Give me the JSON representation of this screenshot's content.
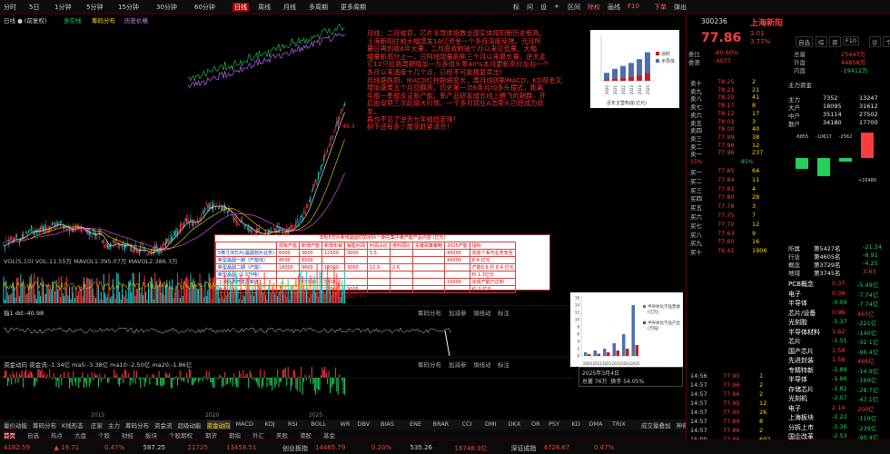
{
  "top_tabs": [
    "分时",
    "5日",
    "1分钟",
    "5分钟",
    "15分钟",
    "30分钟",
    "60分钟",
    "日线",
    "周线",
    "月线",
    "多周期",
    "更多周期"
  ],
  "top_right": [
    "标",
    "问",
    "设",
    "+",
    "区间",
    "除权",
    "画线",
    "F10",
    "下单",
    "弹出"
  ],
  "ticker_title": "300236 上海新阳",
  "main_legend": [
    {
      "text": "日线 ● (前复权)",
      "color": "#cccccc"
    },
    {
      "text": "多空线",
      "color": "#22d05a"
    },
    {
      "text": "筹码分布",
      "color": "#ffd800"
    },
    {
      "text": "历史价格",
      "color": "#d68cff"
    }
  ],
  "annotation": [
    "月线：二月收官，芯片半导体指数全部实体阳刻新历史新高。",
    "上海新阳往前大幅增发18亿资金一个多月深度反弹。元月所",
    "量日再创收6年大量，二月底收前轴个月以来见低量。大幅",
    "缩量新高分止一，日阿线增量刷新三个月以来最长量，逆天走",
    "它12只拉高周期增加一方多组头筹40%本月更新高价左右一个",
    "多月以来温度十几个点，已经不可能报复卖出！",
    "月线盛跌阴，MACD红柱刷缩变长，周月线则刷MACD，KD双金叉",
    "增加盛周五个月回翻高，历史第一次6条月均多头摆式，距离",
    "年报一季报反证新产能，新产品研发成长线上腾飞的期群，开",
    "启由安禁三次起级大行情，一个多月就业A浩荣头已经成为欢",
    "友。",
    "再也不见了逆天七年栈低走珠！",
    "树下还有多少尾货赶紧清仓！"
  ],
  "price_mark": "49.3",
  "ind1_label": "VOL(5,10) VOL:11.55万 MAVOL1:395.07万 MAVOL2:386.3万",
  "ind2_label": "指1 dd:-40.98",
  "ind3_label": "资金动向  资金流:-1.34亿 ma5:-3.38亿 ma10:-2.50亿 ma20:-1.86亿",
  "ind_btns": [
    "筹码分布",
    "加减参",
    "填线动",
    "标注"
  ],
  "table_title": "本轮5万片新增晶圆切割划片一期在集中量产能产品内容 (亿元)",
  "table_headers": [
    "",
    "现有产能",
    "新增产能",
    "新增年销",
    "销售利润",
    "利润占比",
    "增利润比",
    "关键政策策略",
    "2025产能",
    "指标"
  ],
  "table_rows": [
    [
      "5英寸/8万片(晶圆划片业务)",
      "6000",
      "3000",
      "12500",
      "3000",
      "5.5",
      "",
      "45000",
      "完成个系与业务安全"
    ],
    [
      "新型晶圆一期（产能线）",
      "4500",
      "6500",
      "",
      "",
      "",
      "",
      "43000",
      "8.4 亿元"
    ],
    [
      "新型晶圆二期（产能）",
      "18000",
      "9000",
      "13000",
      "3000",
      "12.9",
      "2.6",
      "",
      "产能5.6 约 8.4 亿元"
    ],
    [
      "新型晶圆（1.3万吨）",
      "",
      "",
      "",
      "",
      "",
      "",
      "",
      "PI 1.3亿元"
    ],
    [
      "上海经济开发区新增",
      "",
      "15000",
      "5000",
      "",
      "",
      "",
      "10000",
      "完成产能已达到"
    ],
    [
      "合计",
      "",
      "",
      "25000",
      "9000",
      "",
      "",
      "",
      "约 3 亿元"
    ]
  ],
  "table_footer": "已达到新产品产能需求的比例，预期是新产品市场规模，销售规模占比 5%",
  "chart1": {
    "type": "bar",
    "categories": [
      "2020",
      "2021",
      "2022",
      "2023",
      "2024",
      "2025"
    ],
    "series": [
      {
        "name": "涂料",
        "values": [
          2,
          3,
          4,
          5,
          7,
          9
        ]
      },
      {
        "name": "半导体",
        "values": [
          6,
          9,
          11,
          13,
          15,
          20
        ]
      }
    ],
    "xlabel": "近年主营构成(亿元)"
  },
  "chart2": {
    "type": "bar",
    "categories": [
      "2020",
      "2021",
      "2022",
      "2023",
      "2024",
      "2025"
    ],
    "series": [
      {
        "name": "半导体化学品营收(亿元)",
        "values": [
          1,
          1.5,
          2,
          3.5,
          6,
          14
        ]
      },
      {
        "name": "半导体化学品产出(万吨)",
        "values": [
          0.5,
          0.6,
          1,
          1.5,
          2,
          3
        ]
      }
    ],
    "ylim": [
      0,
      16
    ]
  },
  "date_box": {
    "date": "2025年3月4日",
    "vol": "总量 76万",
    "pct": "换手 54.05%"
  },
  "sidebar": {
    "code": "300236",
    "name": "上海新阳",
    "price": "77.86",
    "change": "3.01",
    "pct": "3.77%",
    "tabs": [
      "自选",
      "综",
      "资",
      "F10",
      "诊",
      "个"
    ],
    "stats_left": [
      [
        "委比",
        "-60.60%"
      ],
      [
        "委差",
        "-4077"
      ]
    ],
    "stats_right": [
      [
        "总量",
        "25447万"
      ],
      [
        "外盘",
        "44858万"
      ],
      [
        "内盘",
        "-19412万"
      ]
    ],
    "asks": [
      [
        "卖十",
        "78.25",
        "2"
      ],
      [
        "卖九",
        "78.21",
        "21"
      ],
      [
        "卖八",
        "78.20",
        "41"
      ],
      [
        "卖七",
        "78.17",
        "8"
      ],
      [
        "卖六",
        "78.12",
        "17"
      ],
      [
        "卖五",
        "78.01",
        "3"
      ],
      [
        "卖四",
        "78.00",
        "40"
      ],
      [
        "卖三",
        "77.99",
        "38"
      ],
      [
        "卖二",
        "77.98",
        "12"
      ],
      [
        "卖一",
        "77.96",
        "237"
      ]
    ],
    "bids": [
      [
        "买一",
        "77.85",
        "64"
      ],
      [
        "买二",
        "77.84",
        "11"
      ],
      [
        "买三",
        "77.81",
        "4"
      ],
      [
        "买四",
        "77.80",
        "28"
      ],
      [
        "买五",
        "77.78",
        "3"
      ],
      [
        "买六",
        "77.75",
        "7"
      ],
      [
        "买七",
        "77.70",
        "12"
      ],
      [
        "买八",
        "77.63",
        "9"
      ],
      [
        "买九",
        "77.60",
        "16"
      ],
      [
        "买十",
        "76.41",
        "1906"
      ]
    ],
    "flow_title": "主力资金",
    "flow": [
      [
        "主力",
        "7352",
        "13247"
      ],
      [
        "大户",
        "18095",
        "31612"
      ],
      [
        "中户",
        "35114",
        "27502"
      ],
      [
        "散户",
        "34180",
        "17700"
      ]
    ],
    "flow_labels": [
      "-6855",
      "-10617",
      "-2562",
      "+16480"
    ],
    "ranks": [
      [
        "所属",
        "第5427名",
        "-21.24"
      ],
      [
        "行业",
        "第4605名",
        "-8.91"
      ],
      [
        "概念",
        "第3729名",
        "-4.25"
      ],
      [
        "地域",
        "第3745名",
        "3.63"
      ]
    ],
    "concepts": [
      [
        "PCB概念",
        "0.37",
        "-5.49亿"
      ],
      [
        "电子",
        "0.08",
        "-7.74亿"
      ],
      [
        "半导体",
        "-0.09",
        "-7.74亿"
      ],
      [
        "芯片/设备",
        "0.96",
        "465亿"
      ],
      [
        "光刻胶",
        "-1.37",
        "-221亿"
      ],
      [
        "半导体材料",
        "1.62",
        "-140亿"
      ],
      [
        "芯片",
        "-1.51",
        "-32.1亿"
      ],
      [
        "国产芯片",
        "1.58",
        "-96.4亿"
      ],
      [
        "先进封装",
        "1.58",
        "466亿"
      ],
      [
        "专精特新",
        "-1.88",
        "-14.9亿"
      ],
      [
        "半导体",
        "-1.86",
        "-169亿"
      ],
      [
        "存储芯片",
        "-1.82",
        "-28.7亿"
      ],
      [
        "光刻机",
        "-2.07",
        "-47.1亿"
      ],
      [
        "电子",
        "2.14",
        "200亿"
      ],
      [
        "上海板块",
        "-2.22",
        "-119亿"
      ],
      [
        "分拆上市",
        "-2.36",
        "-239亿"
      ],
      [
        "国企改革",
        "-2.53",
        "-90.4亿"
      ]
    ],
    "ticks": [
      [
        "14:56",
        "77.95",
        "1"
      ],
      [
        "14:57",
        "77.96",
        "2"
      ],
      [
        "14:57",
        "77.96",
        "2"
      ],
      [
        "14:57",
        "77.95",
        "12"
      ],
      [
        "14:57",
        "77.90",
        "26"
      ],
      [
        "14:57",
        "77.89",
        "8"
      ],
      [
        "14:57",
        "77.86",
        "2"
      ],
      [
        "15:00",
        "77.86",
        "692"
      ]
    ]
  },
  "ind_tabs": [
    "量价动能",
    "筹码分布",
    "K线形态",
    "庄家",
    "主力",
    "筹码分布",
    "资金流",
    "超级动能",
    "资金动向",
    "MACD",
    "KDJ",
    "RSI",
    "BOLL",
    "WR",
    "DBV",
    "BIAS",
    "ENE",
    "BRAR",
    "CCI",
    "DMI",
    "DKX",
    "OR",
    "PSY",
    "KD",
    "DMA",
    "TRIX",
    "成交量叠加",
    "神奇九转",
    "更多指标"
  ],
  "bot_tabs": [
    "首页",
    "自选",
    "热点",
    "大盘",
    "个股",
    "财经",
    "板块",
    "个股期权",
    "期货",
    "期指",
    "外汇",
    "美股",
    "港股",
    "基金"
  ],
  "bottom_bar": [
    {
      "t": "4182.59",
      "c": "#ff3b3b"
    },
    {
      "t": "▲ 19.71",
      "c": "#ff3b3b"
    },
    {
      "t": "0.47%",
      "c": "#ff3b3b"
    },
    {
      "t": "587.25",
      "c": "#cccccc"
    },
    {
      "t": "21725",
      "c": "#ff3b3b"
    },
    {
      "t": "13458.51",
      "c": "#ff3b3b"
    },
    {
      "t": "创业板指",
      "c": "#cccccc"
    },
    {
      "t": "14465.79",
      "c": "#ff3b3b"
    },
    {
      "t": "0.20%",
      "c": "#ff3b3b"
    },
    {
      "t": "535.26",
      "c": "#cccccc"
    },
    {
      "t": "16748.3亿",
      "c": "#ff3b3b"
    },
    {
      "t": "深证成指",
      "c": "#cccccc"
    },
    {
      "t": "4728.67",
      "c": "#ff3b3b"
    },
    {
      "t": "0.47%",
      "c": "#ff3b3b"
    }
  ]
}
